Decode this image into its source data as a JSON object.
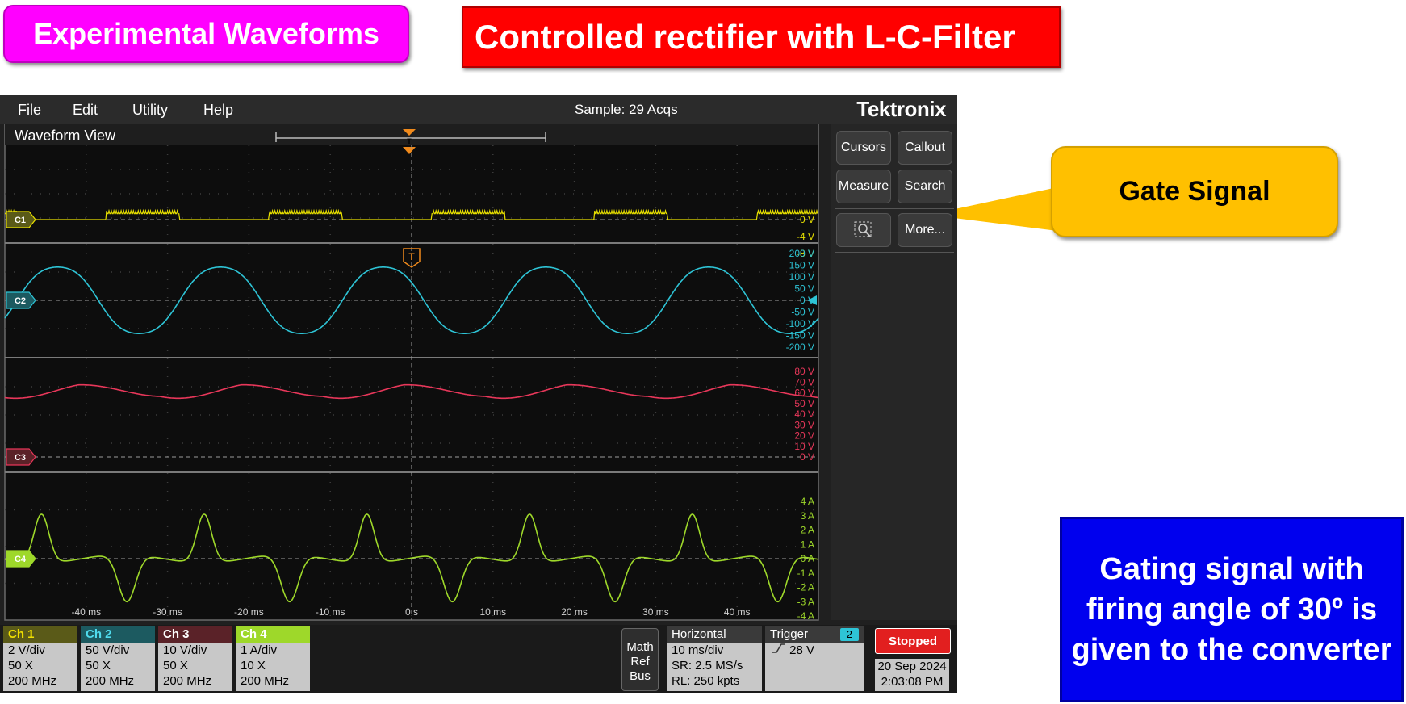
{
  "banners": {
    "experimental": "Experimental Waveforms",
    "title": "Controlled rectifier with L-C-Filter",
    "gate_callout": "Gate Signal",
    "info_lines": [
      "Gating signal with",
      "firing angle of 30º is",
      "given to the converter"
    ]
  },
  "scope": {
    "menu": [
      "File",
      "Edit",
      "Utility",
      "Help"
    ],
    "sample": "Sample: 29 Acqs",
    "logo": "Tektronix",
    "waveform_view": "Waveform View",
    "trigger_marker": "T",
    "sidebar": {
      "cursors": "Cursors",
      "callout": "Callout",
      "measure": "Measure",
      "search": "Search",
      "more": "More..."
    },
    "channels": [
      {
        "label": "C1",
        "color": "#e8e000",
        "ticks": [
          "0 V",
          "-4 V",
          "-8 V"
        ]
      },
      {
        "label": "C2",
        "color": "#2ec4d6",
        "ticks": [
          "200 V",
          "150 V",
          "100 V",
          "50 V",
          "0 V",
          "-50 V",
          "-100 V",
          "-150 V",
          "-200 V"
        ]
      },
      {
        "label": "C3",
        "color": "#e8375a",
        "ticks": [
          "80 V",
          "70 V",
          "60 V",
          "50 V",
          "40 V",
          "30 V",
          "20 V",
          "10 V",
          "0 V"
        ]
      },
      {
        "label": "C4",
        "color": "#9ed82a",
        "ticks": [
          "4 A",
          "3 A",
          "2 A",
          "1 A",
          "0 A",
          "-1 A",
          "-2 A",
          "-3 A",
          "-4 A"
        ]
      }
    ],
    "time_ticks": [
      "-40 ms",
      "-30 ms",
      "-20 ms",
      "-10 ms",
      "0 s",
      "10 ms",
      "20 ms",
      "30 ms",
      "40 ms"
    ],
    "channel_settings": [
      {
        "name": "Ch 1",
        "lines": [
          "2 V/div",
          "50 X",
          "200 MHz"
        ],
        "color": "#e0d000"
      },
      {
        "name": "Ch 2",
        "lines": [
          "50 V/div",
          "50 X",
          "200 MHz"
        ],
        "color": "#2ec4d6"
      },
      {
        "name": "Ch 3",
        "lines": [
          "10 V/div",
          "50 X",
          "200 MHz"
        ],
        "color": "#e8375a"
      },
      {
        "name": "Ch 4",
        "lines": [
          "1 A/div",
          "10 X",
          "200 MHz"
        ],
        "color": "#9ed82a"
      }
    ],
    "math_ref_bus": [
      "Math",
      "Ref",
      "Bus"
    ],
    "horizontal": {
      "title": "Horizontal",
      "lines": [
        "10 ms/div",
        "SR: 2.5 MS/s",
        "RL: 250 kpts"
      ]
    },
    "trigger": {
      "title": "Trigger",
      "channel": "2",
      "level": "28 V"
    },
    "status": "Stopped",
    "date": "20 Sep 2024",
    "time": "2:03:08 PM"
  }
}
